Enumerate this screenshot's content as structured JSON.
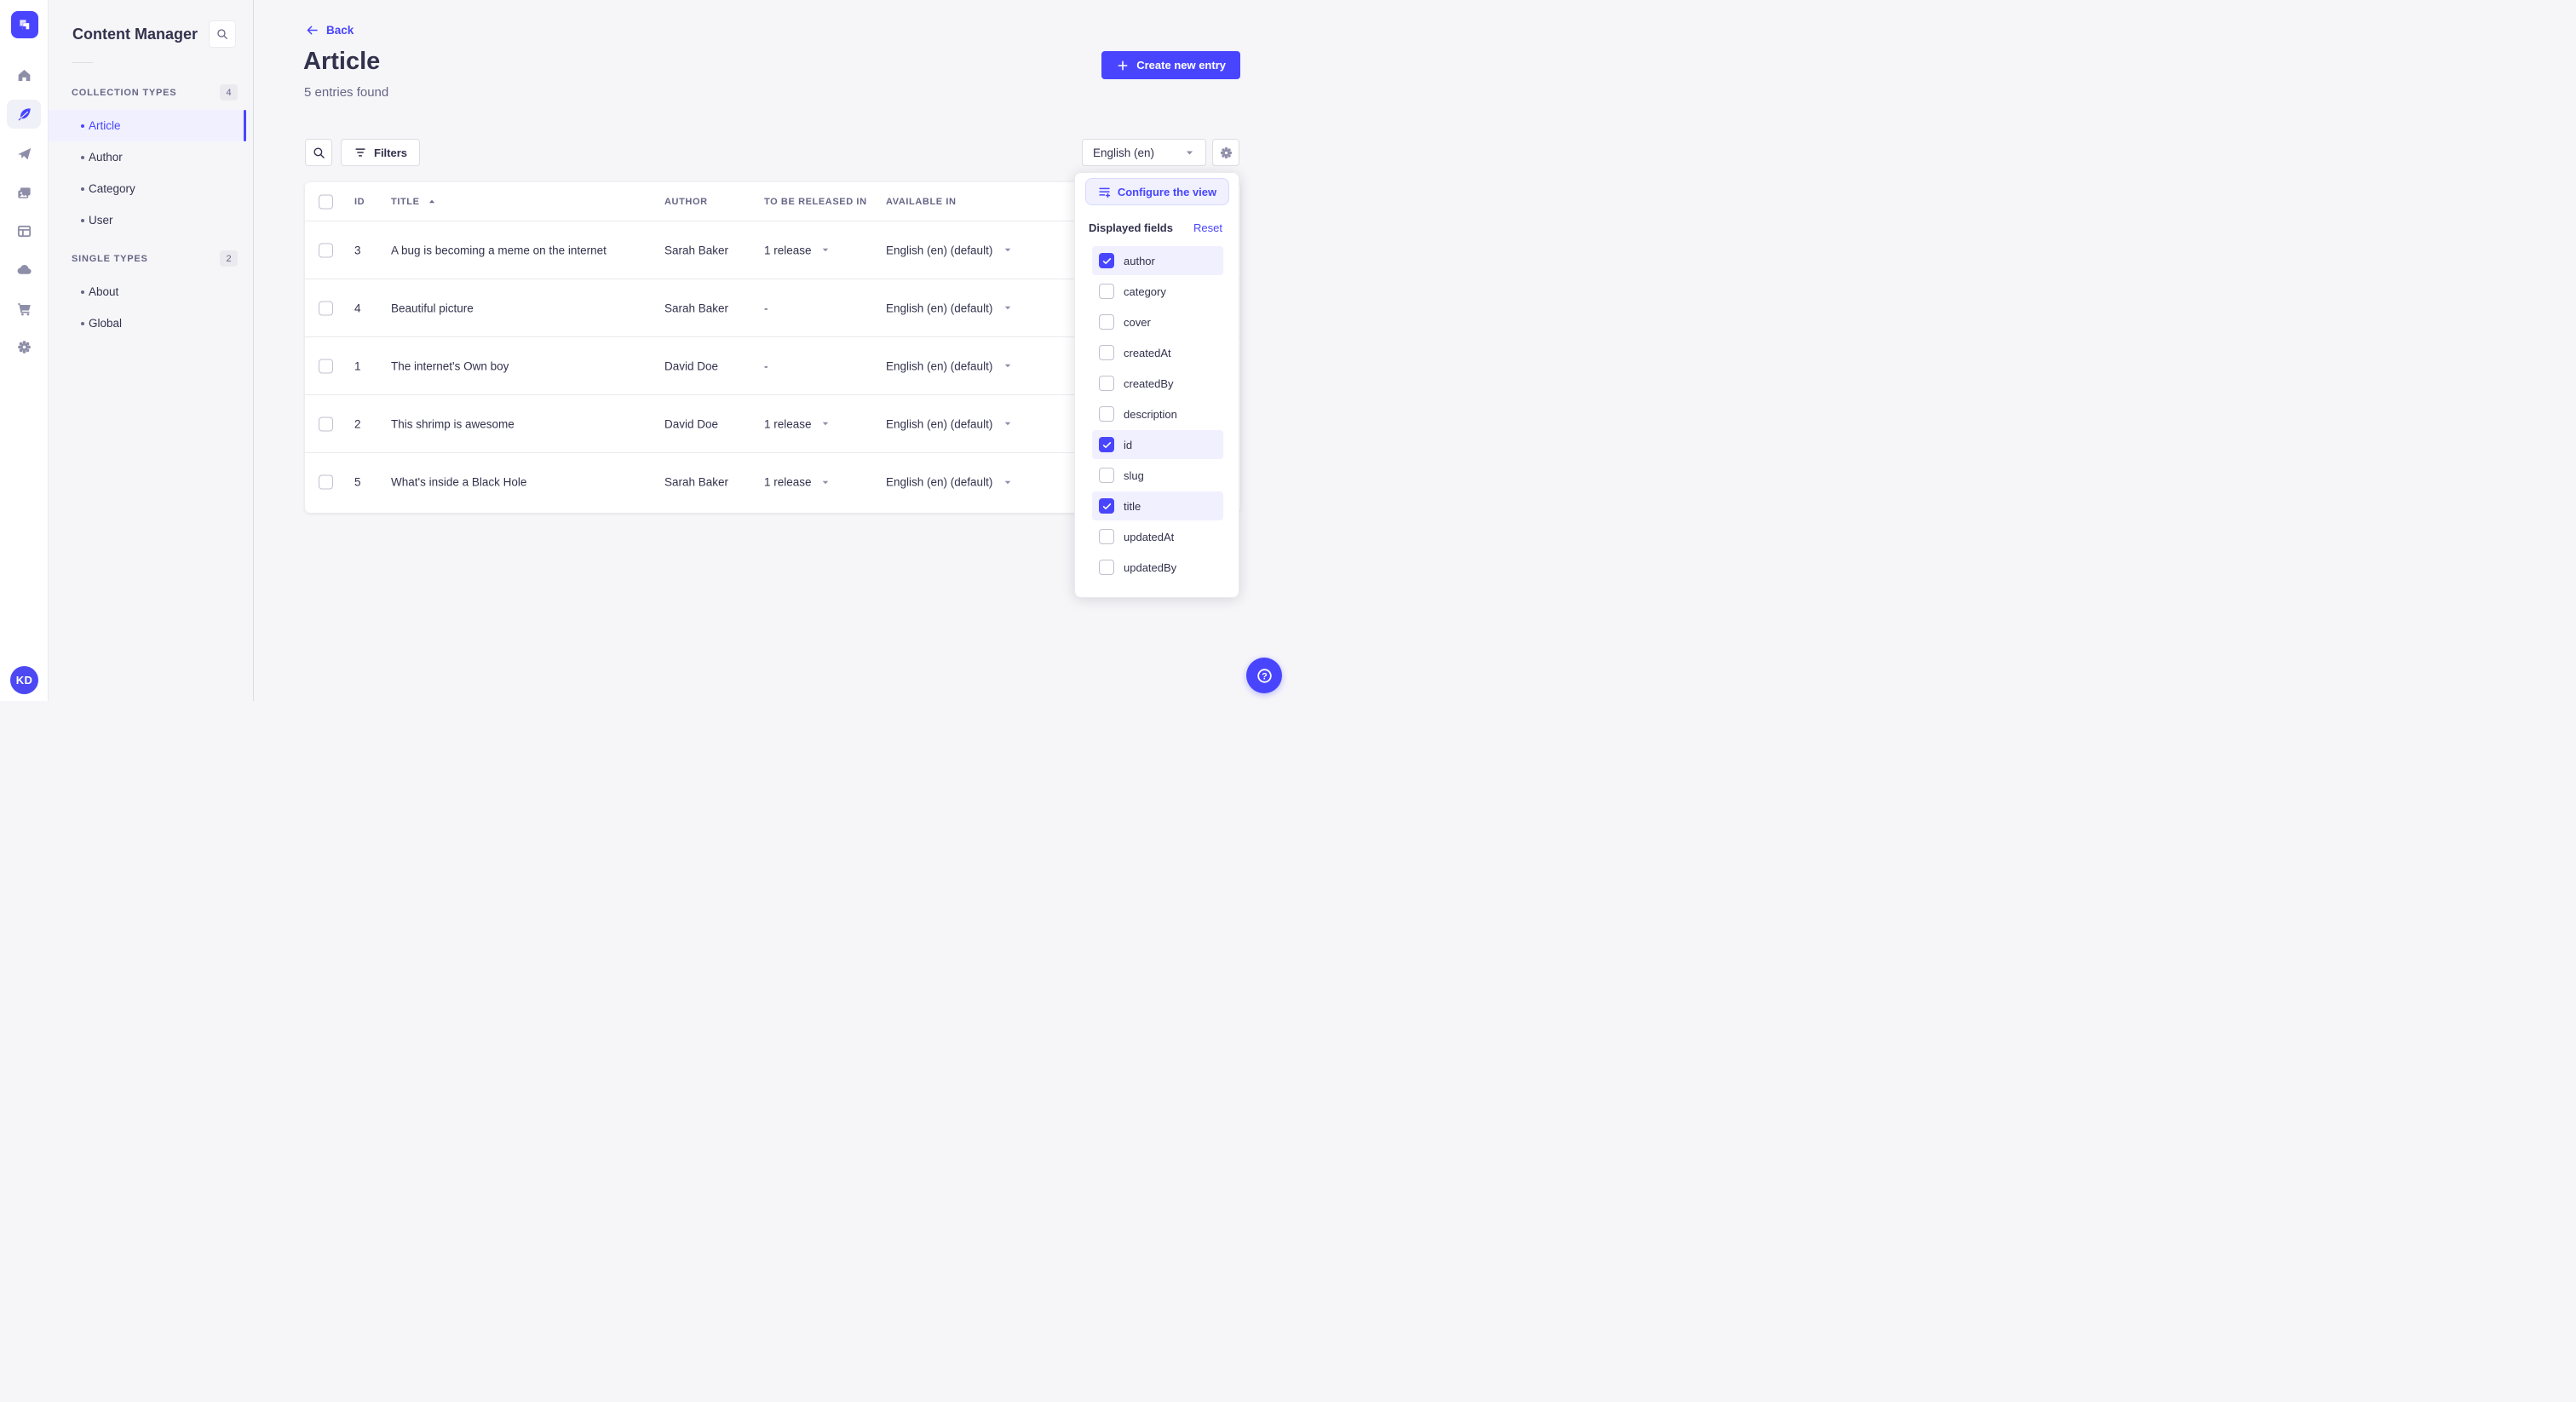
{
  "colors": {
    "accent": "#4945ff",
    "accent_light": "#f0f0ff",
    "text": "#32324d",
    "text_secondary": "#666687",
    "icon": "#8e8ea9",
    "border": "#dcdce4",
    "background": "#f6f6f9"
  },
  "sidebar": {
    "app_title": "Content Manager",
    "avatar_initials": "KD",
    "rail_icons": [
      "home-icon",
      "content-manager-feather-icon",
      "paper-plane-icon",
      "media-library-icon",
      "content-type-builder-icon",
      "cloud-icon",
      "marketplace-cart-icon",
      "settings-gear-icon"
    ],
    "collection_types": {
      "label": "COLLECTION TYPES",
      "count": "4",
      "items": [
        {
          "label": "Article",
          "active": true
        },
        {
          "label": "Author",
          "active": false
        },
        {
          "label": "Category",
          "active": false
        },
        {
          "label": "User",
          "active": false
        }
      ]
    },
    "single_types": {
      "label": "SINGLE TYPES",
      "count": "2",
      "items": [
        {
          "label": "About",
          "active": false
        },
        {
          "label": "Global",
          "active": false
        }
      ]
    }
  },
  "header": {
    "back_label": "Back",
    "title": "Article",
    "subtitle": "5 entries found",
    "create_button_label": "Create new entry"
  },
  "toolbar": {
    "filters_label": "Filters",
    "locale_value": "English (en)"
  },
  "table": {
    "columns": {
      "id": "ID",
      "title": "TITLE",
      "author": "AUTHOR",
      "release": "TO BE RELEASED IN",
      "available": "AVAILABLE IN"
    },
    "sort": {
      "column": "TITLE",
      "direction": "ascending"
    },
    "rows": [
      {
        "id": "3",
        "title": "A bug is becoming a meme on the internet",
        "author": "Sarah Baker",
        "release": "1 release",
        "has_release_menu": true,
        "available": "English (en) (default)"
      },
      {
        "id": "4",
        "title": "Beautiful picture",
        "author": "Sarah Baker",
        "release": "-",
        "has_release_menu": false,
        "available": "English (en) (default)"
      },
      {
        "id": "1",
        "title": "The internet's Own boy",
        "author": "David Doe",
        "release": "-",
        "has_release_menu": false,
        "available": "English (en) (default)"
      },
      {
        "id": "2",
        "title": "This shrimp is awesome",
        "author": "David Doe",
        "release": "1 release",
        "has_release_menu": true,
        "available": "English (en) (default)"
      },
      {
        "id": "5",
        "title": "What's inside a Black Hole",
        "author": "Sarah Baker",
        "release": "1 release",
        "has_release_menu": true,
        "available": "English (en) (default)"
      }
    ]
  },
  "popover": {
    "configure_label": "Configure the view",
    "displayed_fields_label": "Displayed fields",
    "reset_label": "Reset",
    "fields": [
      {
        "label": "author",
        "checked": true
      },
      {
        "label": "category",
        "checked": false
      },
      {
        "label": "cover",
        "checked": false
      },
      {
        "label": "createdAt",
        "checked": false
      },
      {
        "label": "createdBy",
        "checked": false
      },
      {
        "label": "description",
        "checked": false
      },
      {
        "label": "id",
        "checked": true
      },
      {
        "label": "slug",
        "checked": false
      },
      {
        "label": "title",
        "checked": true
      },
      {
        "label": "updatedAt",
        "checked": false
      },
      {
        "label": "updatedBy",
        "checked": false
      }
    ]
  },
  "help": {
    "tooltip": "?"
  }
}
